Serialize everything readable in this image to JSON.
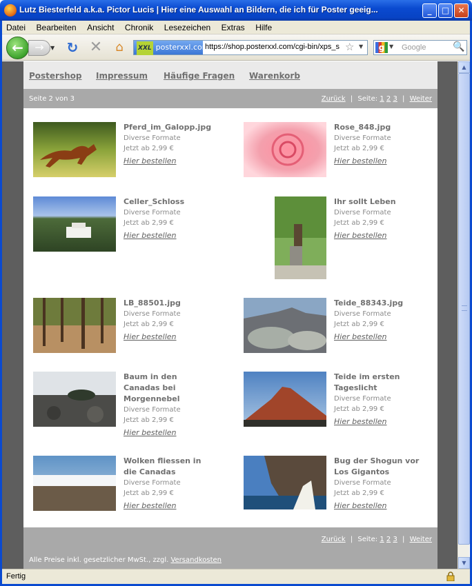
{
  "window": {
    "title": "Lutz Biesterfeld a.k.a. Pictor Lucis | Hier eine Auswahl an Bildern, die ich für Poster geeig...",
    "minimize_label": "_",
    "maximize_label": "□",
    "close_label": "✕"
  },
  "menu": [
    "Datei",
    "Bearbeiten",
    "Ansicht",
    "Chronik",
    "Lesezeichen",
    "Extras",
    "Hilfe"
  ],
  "toolbar": {
    "site_identity": "posterxxl.com",
    "site_badge": "XXL",
    "url": "https://shop.posterxxl.com/cgi-bin/xps_s",
    "search_placeholder": "Google"
  },
  "site_nav": [
    "Postershop",
    "Impressum",
    "Häufige Fragen",
    "Warenkorb"
  ],
  "pager": {
    "page_label": "Seite 2 von 3",
    "back": "Zurück",
    "separator": "|",
    "pages_label": "Seite:",
    "pages": [
      "1",
      "2",
      "3"
    ],
    "next": "Weiter"
  },
  "products": [
    {
      "name": "Pferd_im_Galopp.jpg",
      "formats": "Diverse Formate",
      "price": "Jetzt ab 2,99 €",
      "order": "Hier bestellen"
    },
    {
      "name": "Rose_848.jpg",
      "formats": "Diverse Formate",
      "price": "Jetzt ab 2,99 €",
      "order": "Hier bestellen"
    },
    {
      "name": "Celler_Schloss",
      "formats": "Diverse Formate",
      "price": "Jetzt ab 2,99 €",
      "order": "Hier bestellen"
    },
    {
      "name": "Ihr sollt Leben",
      "formats": "Diverse Formate",
      "price": "Jetzt ab 2,99 €",
      "order": "Hier bestellen"
    },
    {
      "name": "LB_88501.jpg",
      "formats": "Diverse Formate",
      "price": "Jetzt ab 2,99 €",
      "order": "Hier bestellen"
    },
    {
      "name": "Teide_88343.jpg",
      "formats": "Diverse Formate",
      "price": "Jetzt ab 2,99 €",
      "order": "Hier bestellen"
    },
    {
      "name_lines": [
        "Baum in den",
        "Canadas bei",
        "Morgennebel"
      ],
      "formats": "Diverse Formate",
      "price": "Jetzt ab 2,99 €",
      "order": "Hier bestellen"
    },
    {
      "name_lines": [
        "Teide im ersten",
        "Tageslicht"
      ],
      "formats": "Diverse Formate",
      "price": "Jetzt ab 2,99 €",
      "order": "Hier bestellen"
    },
    {
      "name_lines": [
        "Wolken fliessen in",
        "die Canadas"
      ],
      "formats": "Diverse Formate",
      "price": "Jetzt ab 2,99 €",
      "order": "Hier bestellen"
    },
    {
      "name_lines": [
        "Bug der Shogun vor",
        "Los Gigantos"
      ],
      "formats": "Diverse Formate",
      "price": "Jetzt ab 2,99 €",
      "order": "Hier bestellen"
    }
  ],
  "footer": {
    "note": "Alle Preise inkl. gesetzlicher MwSt., zzgl.",
    "shipping_link": "Versandkosten"
  },
  "status": {
    "text": "Fertig"
  },
  "colors": {
    "title_bar": "#0a4ad0",
    "page_nav_bg": "#eaeaea",
    "pager_bg": "#a9a9a9",
    "page_backdrop": "#5e5e5e",
    "link_text": "#707070"
  }
}
